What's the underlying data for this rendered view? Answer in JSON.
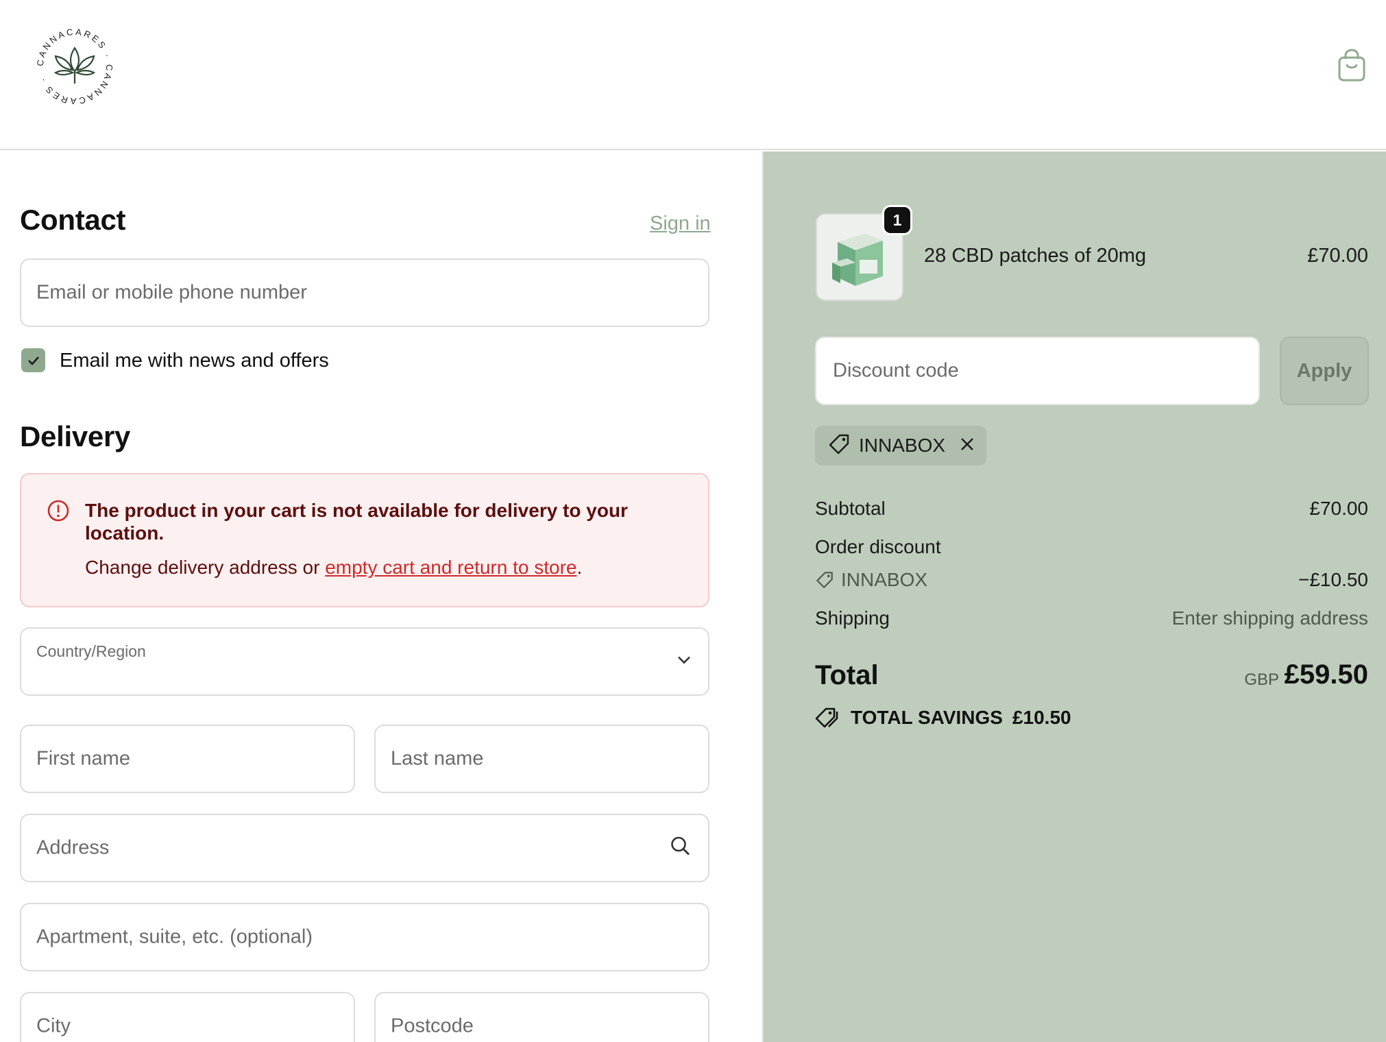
{
  "header": {
    "logo_text": "CANNACARES · CANNACARES ·",
    "cart_icon": "shopping-bag-icon"
  },
  "contact": {
    "heading": "Contact",
    "sign_in": "Sign in",
    "email_placeholder": "Email or mobile phone number",
    "newsletter_checked": true,
    "newsletter_label": "Email me with news and offers"
  },
  "delivery": {
    "heading": "Delivery",
    "alert": {
      "title": "The product in your cart is not available for delivery to your location.",
      "body_prefix": "Change delivery address or ",
      "link": "empty cart and return to store",
      "body_suffix": "."
    },
    "country_label": "Country/Region",
    "first_name": "First name",
    "last_name": "Last name",
    "address": "Address",
    "apartment": "Apartment, suite, etc. (optional)",
    "city": "City",
    "postcode": "Postcode"
  },
  "summary": {
    "item": {
      "quantity": "1",
      "title": "28 CBD patches of 20mg",
      "price": "£70.00"
    },
    "discount_placeholder": "Discount code",
    "apply": "Apply",
    "applied_code": "INNABOX",
    "subtotal_label": "Subtotal",
    "subtotal_value": "£70.00",
    "order_discount_label": "Order discount",
    "order_discount_code": "INNABOX",
    "order_discount_value": "−£10.50",
    "shipping_label": "Shipping",
    "shipping_value": "Enter shipping address",
    "total_label": "Total",
    "total_currency": "GBP",
    "total_value": "£59.50",
    "savings_label": "TOTAL SAVINGS",
    "savings_value": "£10.50"
  },
  "colors": {
    "accent": "#8fa98f",
    "summary_bg": "#bfcdbc",
    "error_text": "#5c0f0f",
    "error_link": "#cc2a2a"
  }
}
